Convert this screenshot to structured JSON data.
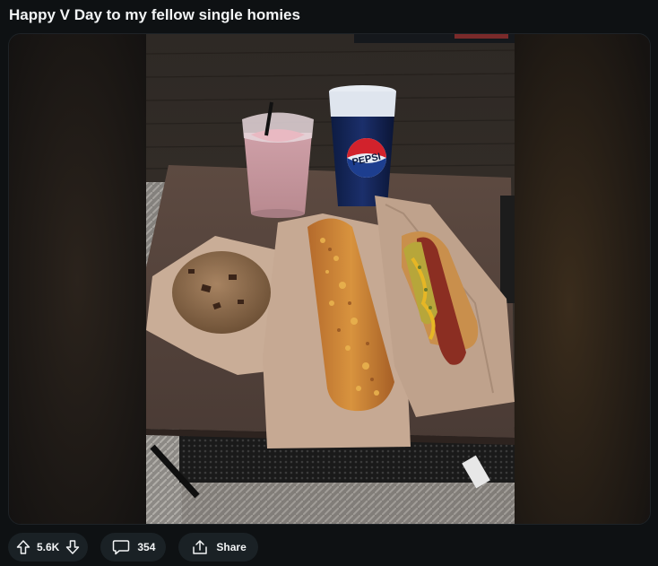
{
  "post": {
    "title": "Happy V Day to my fellow single homies"
  },
  "media": {
    "cup_brand": "PEPSI"
  },
  "actions": {
    "vote_count": "5.6K",
    "comment_count": "354",
    "share_label": "Share"
  },
  "icons": {
    "upvote": "arrow-up-outline-icon",
    "downvote": "arrow-down-outline-icon",
    "comment": "speech-bubble-icon",
    "share": "share-arrow-icon"
  }
}
